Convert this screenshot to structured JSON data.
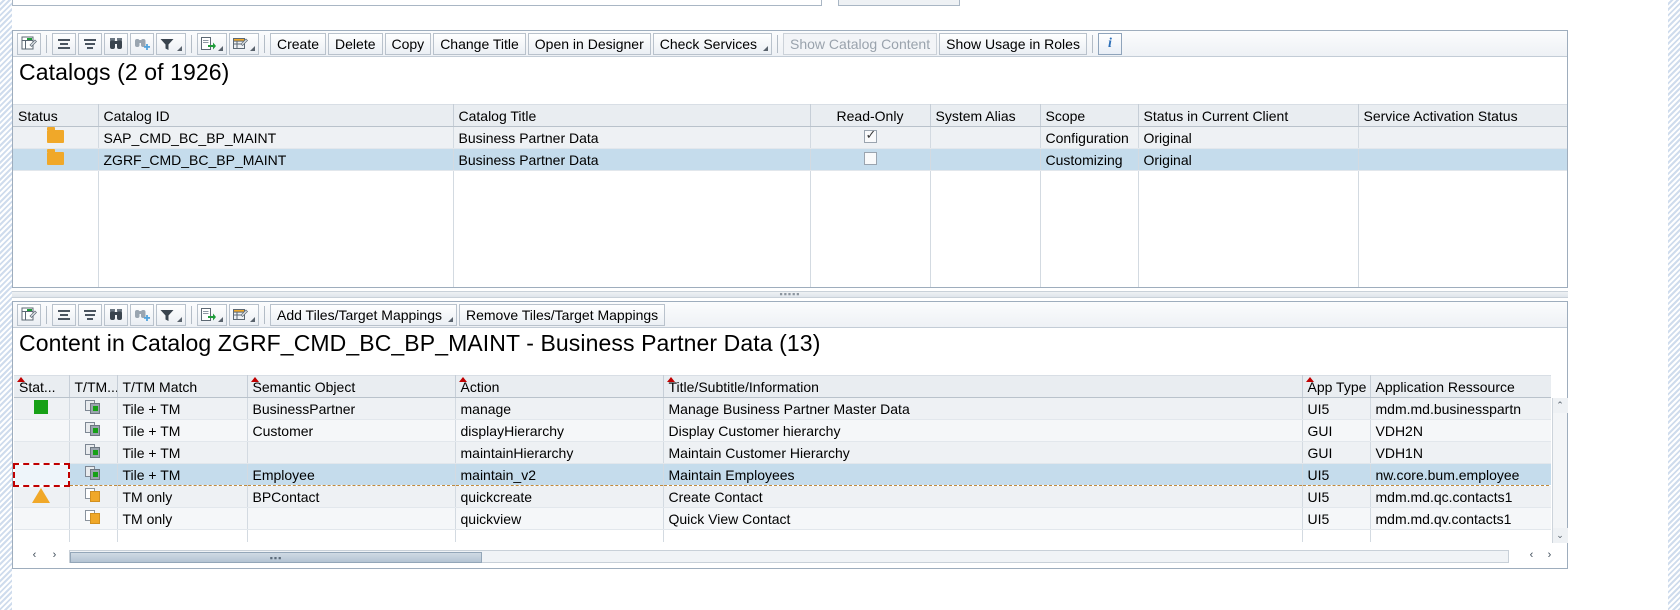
{
  "upper": {
    "toolbar": {
      "icons": [
        {
          "name": "layout-settings-icon",
          "glyph": "grid-pencil"
        },
        {
          "name": "sort-ascending-icon",
          "glyph": "sort-asc"
        },
        {
          "name": "sort-descending-icon",
          "glyph": "sort-desc"
        },
        {
          "name": "find-icon",
          "glyph": "binoculars"
        },
        {
          "name": "find-next-icon",
          "glyph": "binoculars-plus"
        },
        {
          "name": "filter-icon",
          "glyph": "filter"
        },
        {
          "name": "export-icon",
          "glyph": "export"
        },
        {
          "name": "personalize-icon",
          "glyph": "personalize"
        }
      ],
      "buttons": [
        {
          "label": "Create",
          "name": "create-button",
          "disabled": false,
          "caret": false
        },
        {
          "label": "Delete",
          "name": "delete-button",
          "disabled": false,
          "caret": false
        },
        {
          "label": "Copy",
          "name": "copy-button",
          "disabled": false,
          "caret": false
        },
        {
          "label": "Change Title",
          "name": "change-title-button",
          "disabled": false,
          "caret": false
        },
        {
          "label": "Open in Designer",
          "name": "open-in-designer-button",
          "disabled": false,
          "caret": false
        },
        {
          "label": "Check Services",
          "name": "check-services-button",
          "disabled": false,
          "caret": true
        },
        {
          "label": "Show Catalog Content",
          "name": "show-catalog-content-button",
          "disabled": true,
          "caret": false
        },
        {
          "label": "Show Usage in Roles",
          "name": "show-usage-in-roles-button",
          "disabled": false,
          "caret": false
        }
      ],
      "info_label": "i"
    },
    "title": "Catalogs (2 of 1926)",
    "columns": [
      "Status",
      "Catalog ID",
      "Catalog Title",
      "Read-Only",
      "System Alias",
      "Scope",
      "Status in Current Client",
      "Service Activation Status"
    ],
    "rows": [
      {
        "status_icon": "folder-icon",
        "catalog_id": "SAP_CMD_BC_BP_MAINT",
        "catalog_title": "Business Partner Data",
        "read_only": true,
        "system_alias": "",
        "scope": "Configuration",
        "status_in_current_client": "Original",
        "service_activation_status": "",
        "selected": false
      },
      {
        "status_icon": "folder-icon",
        "catalog_id": "ZGRF_CMD_BC_BP_MAINT",
        "catalog_title": "Business Partner Data",
        "read_only": false,
        "system_alias": "",
        "scope": "Customizing",
        "status_in_current_client": "Original",
        "service_activation_status": "",
        "selected": true
      }
    ]
  },
  "lower": {
    "toolbar": {
      "icons": [
        {
          "name": "layout-settings-icon",
          "glyph": "grid-pencil"
        },
        {
          "name": "sort-ascending-icon",
          "glyph": "sort-asc"
        },
        {
          "name": "sort-descending-icon",
          "glyph": "sort-desc"
        },
        {
          "name": "find-icon",
          "glyph": "binoculars"
        },
        {
          "name": "find-next-icon",
          "glyph": "binoculars-plus"
        },
        {
          "name": "filter-icon",
          "glyph": "filter"
        },
        {
          "name": "export-icon",
          "glyph": "export"
        },
        {
          "name": "personalize-icon",
          "glyph": "personalize"
        }
      ],
      "buttons": [
        {
          "label": "Add Tiles/Target Mappings",
          "name": "add-tiles-target-mappings-button",
          "disabled": false,
          "caret": true
        },
        {
          "label": "Remove Tiles/Target Mappings",
          "name": "remove-tiles-target-mappings-button",
          "disabled": false,
          "caret": false
        }
      ]
    },
    "title": "Content in Catalog ZGRF_CMD_BC_BP_MAINT - Business Partner Data (13)",
    "columns": [
      {
        "label": "Stat...",
        "sorted": true
      },
      {
        "label": "T/TM...",
        "sorted": false
      },
      {
        "label": "T/TM Match",
        "sorted": false
      },
      {
        "label": "Semantic Object",
        "sorted": true
      },
      {
        "label": "Action",
        "sorted": true
      },
      {
        "label": "Title/Subtitle/Information",
        "sorted": true
      },
      {
        "label": "App Type",
        "sorted": true
      },
      {
        "label": "Application Ressource",
        "sorted": false
      }
    ],
    "rows": [
      {
        "status": "green-square-icon",
        "tile_icon": "tile-tm-icon",
        "match": "Tile + TM",
        "semantic_object": "BusinessPartner",
        "action": "manage",
        "title_info": "Manage Business Partner Master Data",
        "app_type": "UI5",
        "app_resource": "mdm.md.businesspartn",
        "selected": false
      },
      {
        "status": "",
        "tile_icon": "tile-tm-icon",
        "match": "Tile + TM",
        "semantic_object": "Customer",
        "action": "displayHierarchy",
        "title_info": "Display Customer hierarchy",
        "app_type": "GUI",
        "app_resource": "VDH2N",
        "selected": false
      },
      {
        "status": "",
        "tile_icon": "tile-tm-icon",
        "match": "Tile + TM",
        "semantic_object": "",
        "action": "maintainHierarchy",
        "title_info": "Maintain Customer Hierarchy",
        "app_type": "GUI",
        "app_resource": "VDH1N",
        "selected": false
      },
      {
        "status": "",
        "tile_icon": "tile-tm-icon",
        "match": "Tile + TM",
        "semantic_object": "Employee",
        "action": "maintain_v2",
        "title_info": "Maintain Employees",
        "app_type": "UI5",
        "app_resource": "nw.core.bum.employee",
        "selected": true
      },
      {
        "status": "orange-triangle-icon",
        "tile_icon": "tm-only-icon",
        "match": "TM only",
        "semantic_object": "BPContact",
        "action": "quickcreate",
        "title_info": "Create Contact",
        "app_type": "UI5",
        "app_resource": "mdm.md.qc.contacts1",
        "selected": false
      },
      {
        "status": "",
        "tile_icon": "tm-only-icon",
        "match": "TM only",
        "semantic_object": "",
        "action": "quickview",
        "title_info": "Quick View Contact",
        "app_type": "UI5",
        "app_resource": "mdm.md.qv.contacts1",
        "selected": false
      }
    ],
    "scroll": {
      "left_arrow": "‹",
      "right_arrow": "›",
      "up_arrow": "⌃",
      "down_arrow": "⌄"
    }
  },
  "colors": {
    "selection": "#c5dcec",
    "status_green": "#16a016",
    "status_orange": "#f0a829",
    "accent_blue": "#2d6fb8",
    "sort_marker": "#c00000"
  }
}
